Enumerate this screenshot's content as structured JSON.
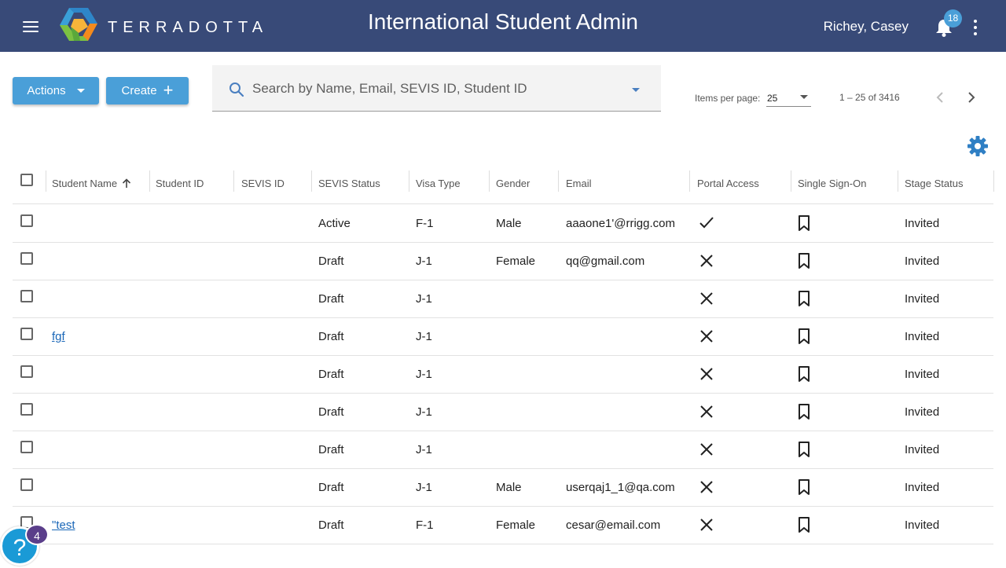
{
  "header": {
    "brand": "TERRADOTTA",
    "title": "International Student Admin",
    "user": "Richey, Casey",
    "notification_count": "18"
  },
  "toolbar": {
    "actions_label": "Actions",
    "create_label": "Create",
    "search_placeholder": "Search by Name, Email, SEVIS ID, Student ID",
    "items_per_page_label": "Items per page:",
    "items_per_page_value": "25",
    "range_label": "1 – 25 of 3416"
  },
  "table": {
    "columns": [
      "Student Name",
      "Student ID",
      "SEVIS ID",
      "SEVIS Status",
      "Visa Type",
      "Gender",
      "Email",
      "Portal Access",
      "Single Sign-On",
      "Stage Status"
    ],
    "rows": [
      {
        "name": "",
        "student_id": "",
        "sevis_id": "",
        "sevis_status": "Active",
        "visa": "F-1",
        "gender": "Male",
        "email": "aaaone1'@rrigg.com",
        "portal": "check",
        "stage": "Invited"
      },
      {
        "name": "",
        "student_id": "",
        "sevis_id": "",
        "sevis_status": "Draft",
        "visa": "J-1",
        "gender": "Female",
        "email": "qq@gmail.com",
        "portal": "x",
        "stage": "Invited"
      },
      {
        "name": "",
        "student_id": "",
        "sevis_id": "",
        "sevis_status": "Draft",
        "visa": "J-1",
        "gender": "",
        "email": "",
        "portal": "x",
        "stage": "Invited"
      },
      {
        "name": "fgf",
        "student_id": "",
        "sevis_id": "",
        "sevis_status": "Draft",
        "visa": "J-1",
        "gender": "",
        "email": "",
        "portal": "x",
        "stage": "Invited"
      },
      {
        "name": "",
        "student_id": "",
        "sevis_id": "",
        "sevis_status": "Draft",
        "visa": "J-1",
        "gender": "",
        "email": "",
        "portal": "x",
        "stage": "Invited"
      },
      {
        "name": "",
        "student_id": "",
        "sevis_id": "",
        "sevis_status": "Draft",
        "visa": "J-1",
        "gender": "",
        "email": "",
        "portal": "x",
        "stage": "Invited"
      },
      {
        "name": "",
        "student_id": "",
        "sevis_id": "",
        "sevis_status": "Draft",
        "visa": "J-1",
        "gender": "",
        "email": "",
        "portal": "x",
        "stage": "Invited"
      },
      {
        "name": "",
        "student_id": "",
        "sevis_id": "",
        "sevis_status": "Draft",
        "visa": "J-1",
        "gender": "Male",
        "email": "userqaj1_1@qa.com",
        "portal": "x",
        "stage": "Invited"
      },
      {
        "name": "\"test",
        "student_id": "",
        "sevis_id": "",
        "sevis_status": "Draft",
        "visa": "F-1",
        "gender": "Female",
        "email": "cesar@email.com",
        "portal": "x",
        "stage": "Invited"
      }
    ]
  },
  "help": {
    "label": "?",
    "badge": "4"
  },
  "colors": {
    "header_bg": "#384a78",
    "accent": "#4a9fd8",
    "link": "#1a67b8"
  }
}
